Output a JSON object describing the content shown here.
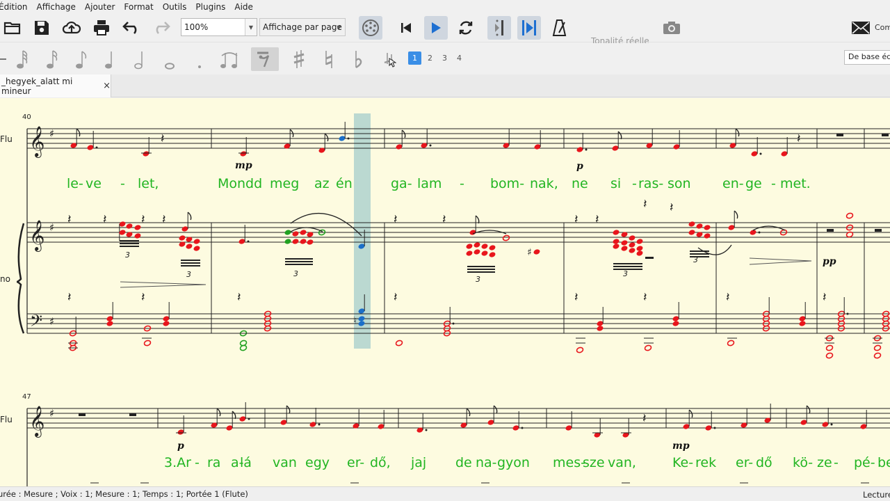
{
  "menubar": {
    "items": [
      "Édition",
      "Affichage",
      "Ajouter",
      "Format",
      "Outils",
      "Plugins",
      "Aide"
    ]
  },
  "toolbar": {
    "zoom": "100%",
    "view_mode": "Affichage par page",
    "tonalite": "Tonalité réelle",
    "comment_label": "Com",
    "icons": [
      "folder-open-icon",
      "save-icon",
      "cloud-upload-icon",
      "print-icon",
      "undo-icon",
      "redo-icon",
      "mixer-icon",
      "rewind-icon",
      "play-icon",
      "loop-icon",
      "loop-in-icon",
      "loop-out-icon",
      "metronome-icon",
      "camera-icon",
      "envelope-icon"
    ]
  },
  "note_input": {
    "voices": [
      "1",
      "2",
      "3",
      "4"
    ],
    "active_voice": "1",
    "workspace": "De base édition"
  },
  "tab": {
    "title": "_hegyek_alatt mi mineur",
    "close": "×"
  },
  "score": {
    "system1": {
      "measure_number": "40",
      "flute_label": "Flu",
      "piano_label": "no",
      "lyrics": [
        "le-",
        "ve",
        "-",
        "let,",
        "Mondd",
        "meg",
        "az",
        "én",
        "ga-",
        "lam",
        "-",
        "bom-",
        "nak,",
        "ne",
        "si",
        "-",
        "ras-",
        "son",
        "en-",
        "ge",
        "-",
        "met."
      ],
      "dynamics": [
        "mp",
        "p",
        "pp"
      ],
      "tuplets": [
        "3",
        "3",
        "3",
        "3",
        "3",
        "3"
      ]
    },
    "system2": {
      "measure_number": "47",
      "flute_label": "Flu",
      "lyrics": [
        "3.Ar",
        "-",
        "ra",
        "a-",
        "lá",
        "van",
        "egy",
        "er-",
        "dő,",
        "jaj",
        "de",
        "na-",
        "gyon",
        "mes-",
        "sze",
        "van,",
        "Ke-",
        "rek",
        "er-",
        "dő",
        "kö-",
        "ze",
        "-",
        "pé-",
        "be"
      ],
      "dynamics": [
        "p",
        "mp"
      ]
    },
    "colors": {
      "voice1": "#e8161c",
      "selection": "#1b6fc9",
      "green": "#21a121",
      "background": "#fdfbe0"
    }
  },
  "statusbar": {
    "text": "urée : Mesure ; Voix : 1;  Mesure : 1; Temps : 1; Portée 1 (Flute)",
    "mode": "Lecture"
  }
}
